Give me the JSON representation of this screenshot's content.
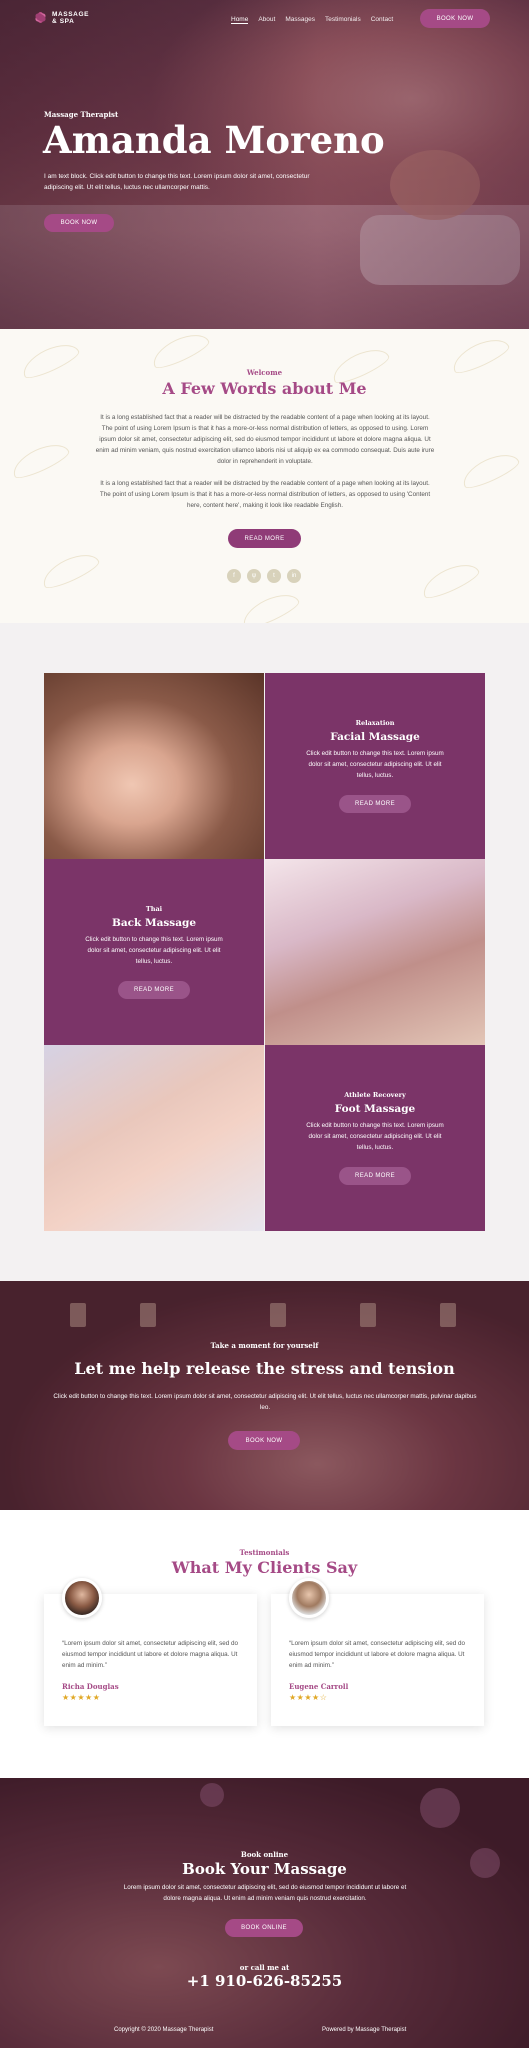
{
  "header": {
    "logo_line1": "MASSAGE",
    "logo_line2": "& SPA",
    "nav": [
      "Home",
      "About",
      "Massages",
      "Testimonials",
      "Contact"
    ],
    "book_now": "BOOK NOW"
  },
  "hero": {
    "kicker": "Massage Therapist",
    "title": "Amanda Moreno",
    "text": "I am text block. Click edit button to change this text. Lorem ipsum dolor sit amet, consectetur adipiscing elit. Ut elit tellus, luctus nec ullamcorper mattis.",
    "button": "BOOK NOW"
  },
  "about": {
    "kicker": "Welcome",
    "title": "A Few Words about Me",
    "para1": "It is a long established fact that a reader will be distracted by the readable content of a page when looking at its layout. The point of using Lorem Ipsum is that it has a more-or-less normal distribution of letters, as opposed to using. Lorem ipsum dolor sit amet, consectetur adipiscing elit, sed do eiusmod tempor incididunt ut labore et dolore magna aliqua. Ut enim ad minim veniam, quis nostrud exercitation ullamco laboris nisi ut aliquip ex ea commodo consequat. Duis aute irure dolor in reprehenderit in voluptate.",
    "para2": "It is a long established fact that a reader will be distracted by the readable content of a page when looking at its layout. The point of using Lorem Ipsum is that it has a more-or-less normal distribution of letters, as opposed to using 'Content here, content here', making it look like readable English.",
    "button": "READ MORE",
    "social": [
      "f",
      "ψ",
      "t",
      "in"
    ]
  },
  "services": [
    {
      "kicker": "Relaxation",
      "title": "Facial Massage",
      "text": "Click edit button to change this text. Lorem ipsum dolor sit amet, consectetur adipiscing elit. Ut elit tellus, luctus.",
      "button": "READ MORE"
    },
    {
      "kicker": "Thai",
      "title": "Back Massage",
      "text": "Click edit button to change this text. Lorem ipsum dolor sit amet, consectetur adipiscing elit. Ut elit tellus, luctus.",
      "button": "READ MORE"
    },
    {
      "kicker": "Athlete Recovery",
      "title": "Foot Massage",
      "text": "Click edit button to change this text. Lorem ipsum dolor sit amet, consectetur adipiscing elit. Ut elit tellus, luctus.",
      "button": "READ MORE"
    }
  ],
  "cta": {
    "kicker": "Take a moment for yourself",
    "title": "Let me help release the stress and tension",
    "text": "Click edit button to change this text. Lorem ipsum dolor sit amet, consectetur adipiscing elit. Ut elit tellus, luctus nec ullamcorper mattis, pulvinar dapibus leo.",
    "button": "BOOK NOW"
  },
  "testimonials": {
    "kicker": "Testimonials",
    "title": "What My Clients Say",
    "items": [
      {
        "quote": "“Lorem ipsum dolor sit amet, consectetur adipiscing elit, sed do eiusmod tempor incididunt ut labore et dolore magna aliqua. Ut enim ad minim.”",
        "name": "Richa Douglas",
        "stars": "★★★★★",
        "rating": 5
      },
      {
        "quote": "“Lorem ipsum dolor sit amet, consectetur adipiscing elit, sed do eiusmod tempor incididunt ut labore et dolore magna aliqua. Ut enim ad minim.”",
        "name": "Eugene Carroll",
        "stars": "★★★★☆",
        "rating": 4.5
      }
    ]
  },
  "booking": {
    "kicker": "Book online",
    "title": "Book Your Massage",
    "text": "Lorem ipsum dolor sit amet, consectetur adipiscing elit, sed do eiusmod tempor incididunt ut labore et dolore magna aliqua. Ut enim ad minim veniam quis nostrud exercitation.",
    "button": "BOOK ONLINE",
    "call_label": "or call me at",
    "phone": "+1 910-626-85255"
  },
  "footer": {
    "copyright": "Copyright © 2020 Massage Therapist",
    "powered": "Powered by Massage Therapist"
  },
  "colors": {
    "brand": "#a54a86",
    "tile": "#7b3468",
    "stars": "#e0a826"
  }
}
